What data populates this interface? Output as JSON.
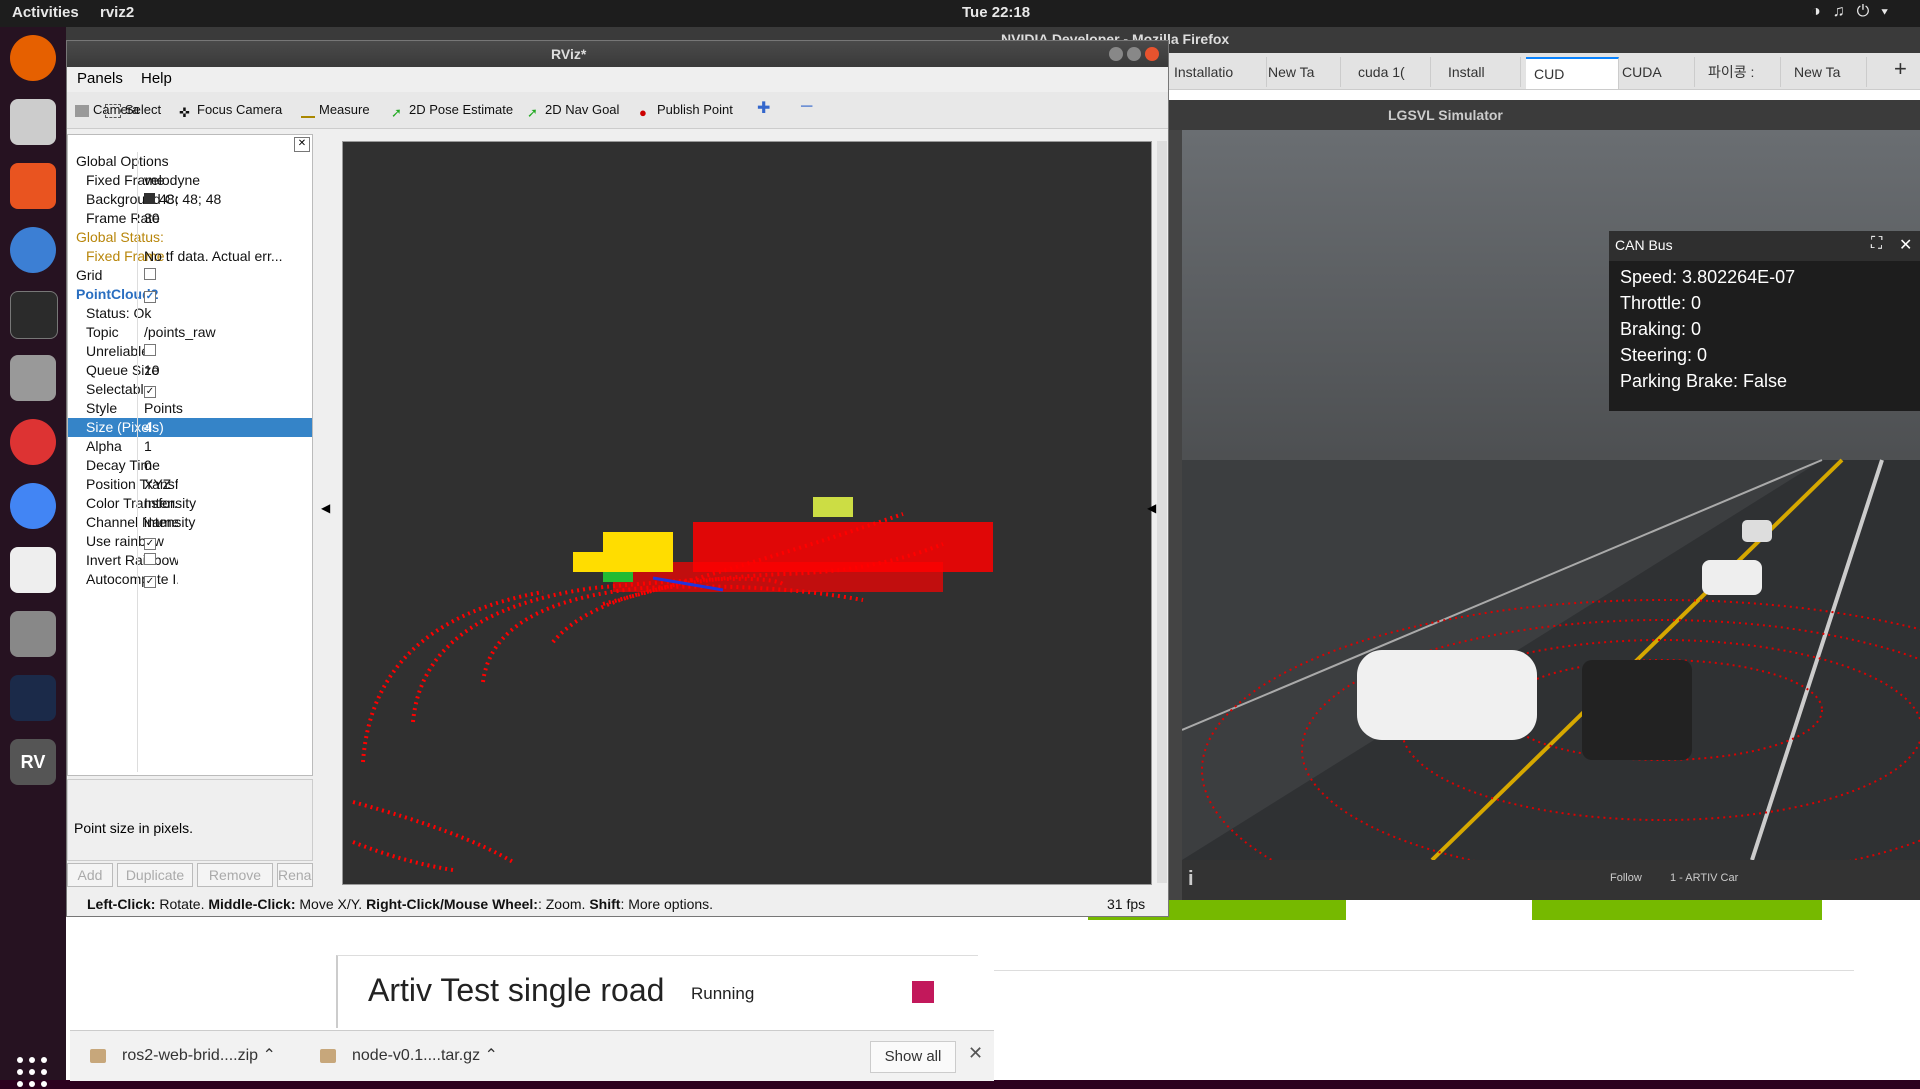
{
  "topbar": {
    "activities": "Activities",
    "app": "rviz2",
    "clock": "Tue 22:18"
  },
  "firefox": {
    "title": "NVIDIA Developer - Mozilla Firefox",
    "tabs": [
      "Installatio",
      "New Ta",
      "cuda 1(",
      "Install",
      "CUD",
      "CUDA",
      "파이콩 :",
      "New Ta"
    ],
    "page": {
      "sim_name": "Artiv Test single road",
      "sim_status": "Running"
    },
    "downloads": {
      "file1": "ros2-web-brid....zip",
      "file2": "node-v0.1....tar.gz",
      "show_all": "Show all"
    }
  },
  "lgsvl": {
    "title": "LGSVL Simulator",
    "canbus": {
      "header": "CAN Bus",
      "speed": "Speed: 3.802264E-07",
      "throttle": "Throttle: 0",
      "braking": "Braking: 0",
      "steering": "Steering: 0",
      "parking": "Parking Brake: False"
    },
    "follow": "Follow",
    "vehicle": "1 - ARTIV Car"
  },
  "rviz": {
    "title": "RViz*",
    "menu": [
      "Panels",
      "Help"
    ],
    "tools": [
      "Camera",
      "Select",
      "Focus Camera",
      "Measure",
      "2D Pose Estimate",
      "2D Nav Goal",
      "Publish Point"
    ],
    "properties": [
      {
        "k": "Global Options",
        "v": ""
      },
      {
        "k": "Fixed Frame",
        "v": "velodyne"
      },
      {
        "k": "Background Color",
        "v": "48; 48; 48"
      },
      {
        "k": "Frame Rate",
        "v": "30"
      },
      {
        "k": "Global Status: ...",
        "v": ""
      },
      {
        "k": "Fixed Frame",
        "v": "No tf data.  Actual err..."
      },
      {
        "k": "Grid",
        "v": ""
      },
      {
        "k": "PointCloud2",
        "v": ""
      },
      {
        "k": "Status: Ok",
        "v": ""
      },
      {
        "k": "Topic",
        "v": "/points_raw"
      },
      {
        "k": "Unreliable",
        "v": ""
      },
      {
        "k": "Queue Size",
        "v": "10"
      },
      {
        "k": "Selectable",
        "v": ""
      },
      {
        "k": "Style",
        "v": "Points"
      },
      {
        "k": "Size (Pixels)",
        "v": "4"
      },
      {
        "k": "Alpha",
        "v": "1"
      },
      {
        "k": "Decay Time",
        "v": "0"
      },
      {
        "k": "Position Transf...",
        "v": "XYZ"
      },
      {
        "k": "Color Transfor...",
        "v": "Intensity"
      },
      {
        "k": "Channel Name",
        "v": "intensity"
      },
      {
        "k": "Use rainbow",
        "v": ""
      },
      {
        "k": "Invert Rainbow",
        "v": ""
      },
      {
        "k": "Autocompute I...",
        "v": ""
      }
    ],
    "description": "Point size in pixels.",
    "buttons": [
      "Add",
      "Duplicate",
      "Remove",
      "Rename"
    ],
    "status_parts": [
      "Left-Click:",
      " Rotate. ",
      "Middle-Click:",
      " Move X/Y. ",
      "Right-Click/Mouse Wheel:",
      ": Zoom. ",
      "Shift",
      ": More options."
    ],
    "fps": "31 fps",
    "background_color": "#303030",
    "point_color": "#ff0000"
  }
}
